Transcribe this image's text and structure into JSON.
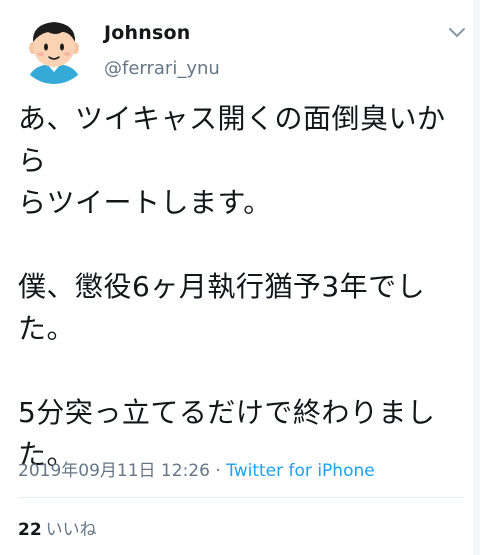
{
  "author": {
    "name": "Johnson",
    "handle": "@ferrari_ynu",
    "avatar": "cartoon-man-avatar-icon"
  },
  "menu": {
    "icon": "chevron-down-icon"
  },
  "tweet": {
    "text": "あ、ツイキャス開くの面倒臭いから\nらツイートします。\n\n僕、懲役6ヶ月執行猶予3年でし\nた。\n\n5分突っ立てるだけで終わりまし\nた。"
  },
  "meta": {
    "timestamp": "2019年09月11日 12:26",
    "separator": " · ",
    "source": "Twitter for iPhone"
  },
  "stats": {
    "likes_count": "22",
    "likes_label": "いいね"
  },
  "colors": {
    "text": "#14171a",
    "secondary": "#657786",
    "link": "#1da1f2",
    "divider": "#e6ecf0"
  }
}
